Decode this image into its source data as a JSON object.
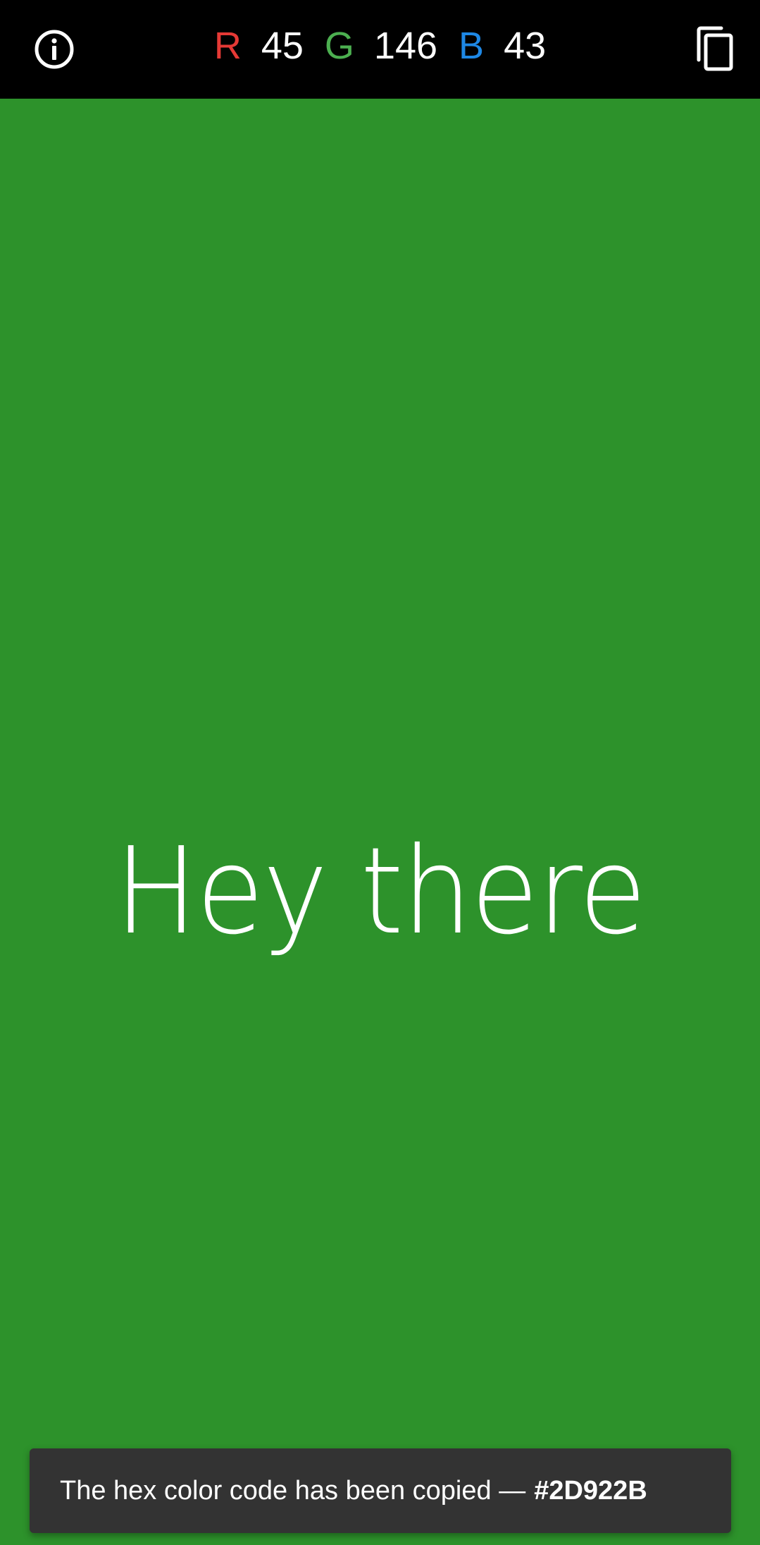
{
  "topbar": {
    "info_icon": "info-icon",
    "copy_icon": "copy-icon",
    "rgb": {
      "r_label": "R",
      "r_value": "45",
      "g_label": "G",
      "g_value": "146",
      "b_label": "B",
      "b_value": "43"
    }
  },
  "colors": {
    "background": "#2D922B",
    "topbar": "#000000",
    "r_label": "#E53935",
    "g_label": "#4CAF50",
    "b_label": "#1E88E5",
    "snackbar": "#333333"
  },
  "main": {
    "greeting": "Hey there"
  },
  "snackbar": {
    "message": "The hex color code has been copied —",
    "hex": "#2D922B"
  }
}
